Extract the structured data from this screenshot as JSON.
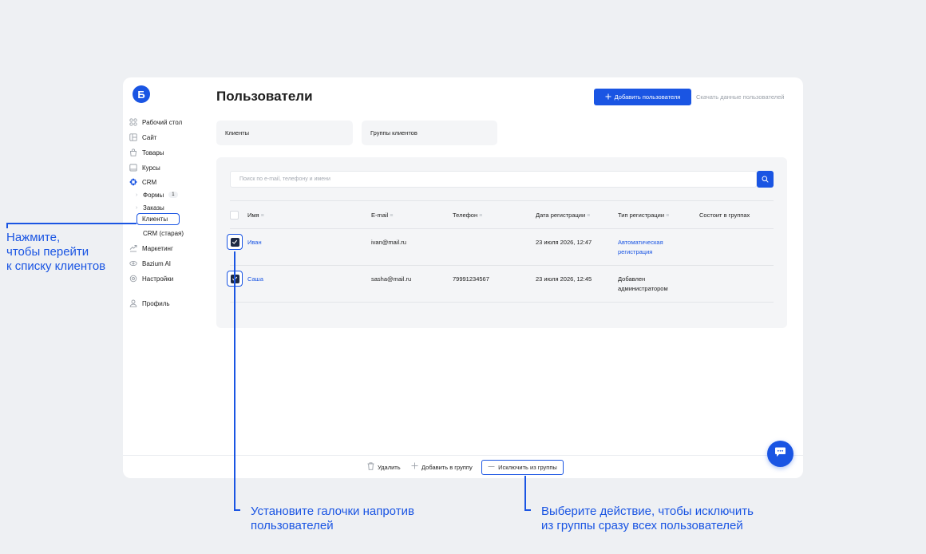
{
  "sidebar": {
    "logo": "Б",
    "items": [
      {
        "label": "Рабочий стол",
        "icon": "dashboard-icon"
      },
      {
        "label": "Сайт",
        "icon": "site-icon"
      },
      {
        "label": "Товары",
        "icon": "bag-icon"
      },
      {
        "label": "Курсы",
        "icon": "book-icon"
      },
      {
        "label": "CRM",
        "icon": "crm-icon"
      }
    ],
    "crm_sub": {
      "forms": "Формы",
      "forms_count": "1",
      "orders": "Заказы",
      "clients": "Клиенты",
      "crm_old": "CRM (старая)"
    },
    "items_after": [
      {
        "label": "Маркетинг",
        "icon": "megaphone-icon"
      },
      {
        "label": "Bazium AI",
        "icon": "ai-icon"
      },
      {
        "label": "Настройки",
        "icon": "gear-icon"
      }
    ],
    "profile": "Профиль"
  },
  "header": {
    "title": "Пользователи",
    "add_user": "Добавить пользователя",
    "download": "Скачать данные пользователей"
  },
  "tabs": [
    "Клиенты",
    "Группы клиентов"
  ],
  "search": {
    "placeholder": "Поиск по e-mail, телефону и имени"
  },
  "table": {
    "columns": [
      "Имя",
      "E-mail",
      "Телефон",
      "Дата регистрации",
      "Тип регистрации",
      "Состоит в группах"
    ],
    "rows": [
      {
        "name": "Иван",
        "email": "ivan@mail.ru",
        "phone": "",
        "date": "23 июля 2026, 12:47",
        "type_line1": "Автоматическая",
        "type_line2": "регистрация",
        "groups": ""
      },
      {
        "name": "Саша",
        "email": "sasha@mail.ru",
        "phone": "79991234567",
        "date": "23 июля 2026, 12:45",
        "type_line1": "Добавлен",
        "type_line2": "администратором",
        "groups": ""
      }
    ]
  },
  "bottom_actions": {
    "delete": "Удалить",
    "add_to_group": "Добавить в группу",
    "exclude": "Исключить из группы"
  },
  "annotations": {
    "left_1": "Нажмите,",
    "left_2": "чтобы перейти",
    "left_3": "к списку клиентов",
    "bottom_left_1": "Установите галочки напротив",
    "bottom_left_2": "пользователей",
    "bottom_right_1": "Выберите действие, чтобы исключить",
    "bottom_right_2": "из группы сразу всех пользователей"
  },
  "colors": {
    "accent": "#1a55e3",
    "background": "#eef0f3",
    "panel": "#f4f5f7"
  }
}
